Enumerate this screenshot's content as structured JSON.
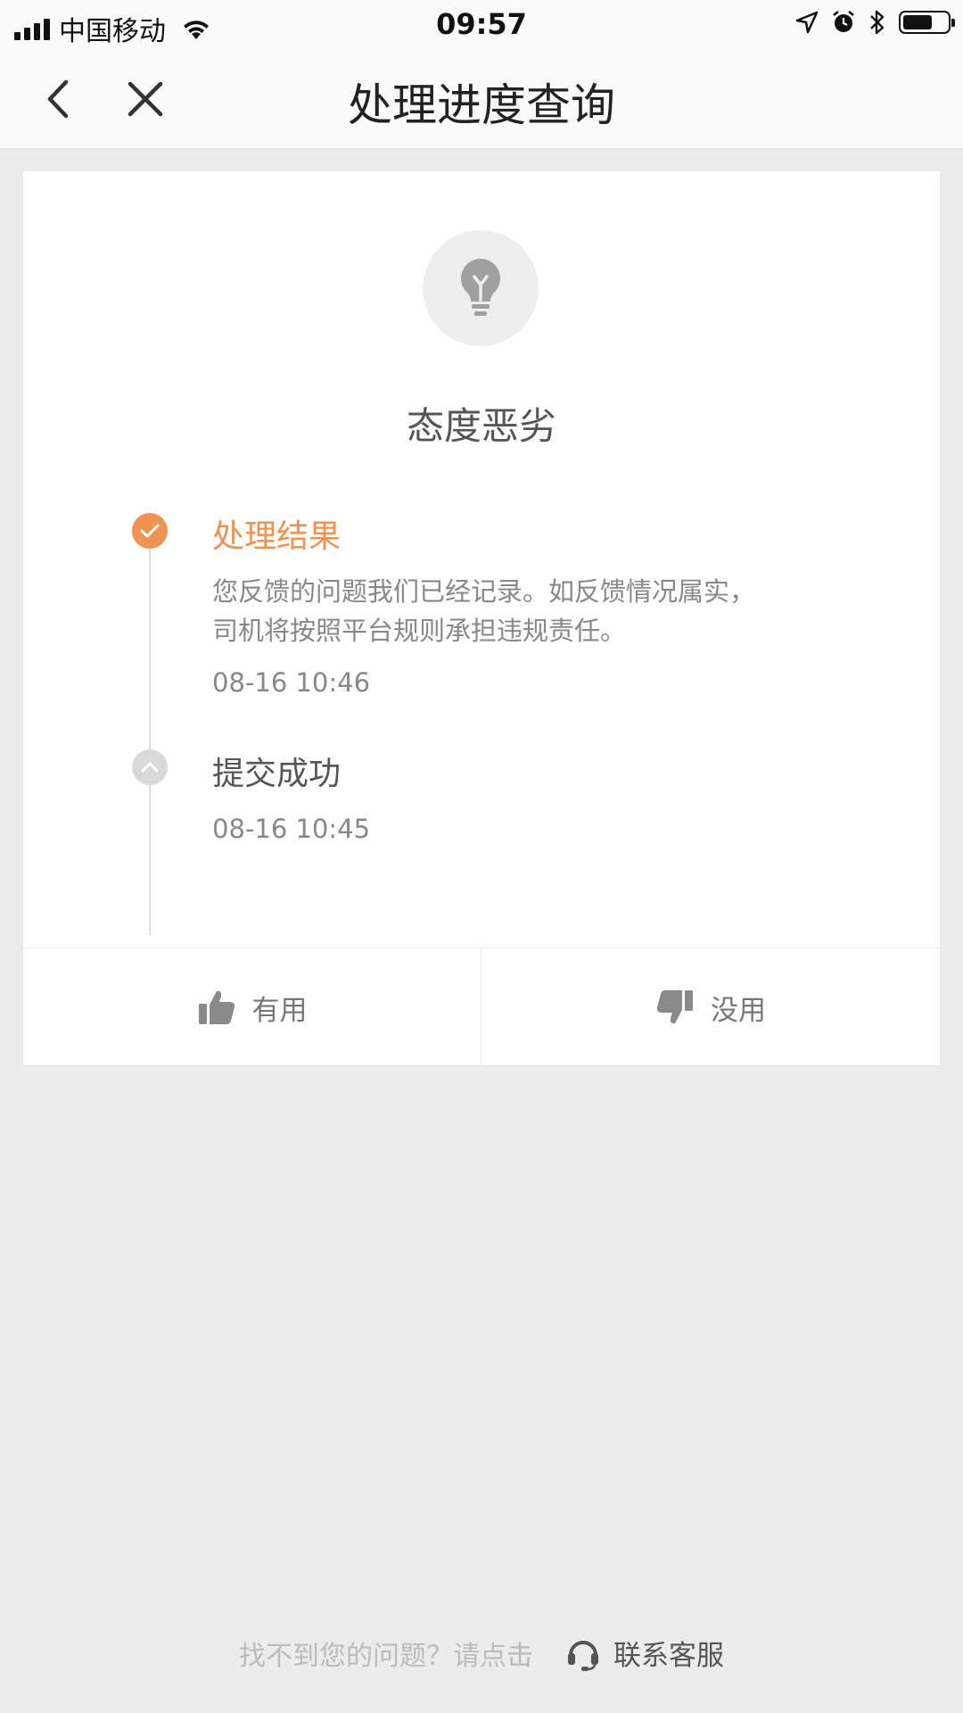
{
  "status_bar": {
    "carrier": "中国移动",
    "time": "09:57",
    "icons": [
      "signal-icon",
      "wifi-icon",
      "location-icon",
      "alarm-icon",
      "bluetooth-icon",
      "battery-icon"
    ]
  },
  "nav": {
    "title": "处理进度查询",
    "back_icon": "chevron-left-icon",
    "close_icon": "close-icon"
  },
  "issue": {
    "icon": "lightbulb-icon",
    "title": "态度恶劣"
  },
  "timeline": [
    {
      "title": "处理结果",
      "description_lines": [
        "您反馈的问题我们已经记录。如反馈情况属实，",
        "司机将按照平台规则承担违规责任。"
      ],
      "time": "08-16 10:46",
      "status": "done",
      "color": "#f09254"
    },
    {
      "title": "提交成功",
      "time": "08-16 10:45",
      "status": "submitted",
      "color": "#d9d9d9"
    }
  ],
  "feedback": {
    "useful_label": "有用",
    "useless_label": "没用"
  },
  "footer": {
    "prompt": "找不到您的问题？请点击",
    "contact_label": "联系客服"
  },
  "colors": {
    "accent": "#f09254",
    "background": "#edecec"
  }
}
